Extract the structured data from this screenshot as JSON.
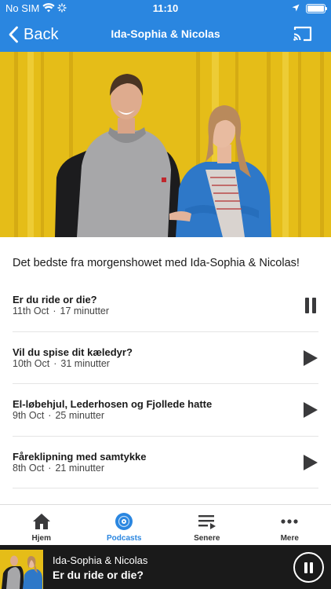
{
  "status_bar": {
    "carrier": "No SIM",
    "time": "11:10",
    "icons": [
      "wifi-icon",
      "activity-spinner-icon",
      "location-arrow-icon",
      "battery-icon"
    ]
  },
  "nav": {
    "back_label": "Back",
    "title": "Ida-Sophia & Nicolas",
    "icons": [
      "chevron-left-icon",
      "cast-icon"
    ]
  },
  "colors": {
    "brand_blue": "#2a86e0",
    "player_bg": "#1a1a1a",
    "hero_yellow": "#e8c21a"
  },
  "description": "Det bedste fra morgenshowet med Ida-Sophia & Nicolas!",
  "episodes": [
    {
      "title": "Er du ride or die?",
      "date": "11th Oct",
      "duration": "17 minutter",
      "state": "playing",
      "control_icon": "pause-icon"
    },
    {
      "title": "Vil du spise dit kæledyr?",
      "date": "10th Oct",
      "duration": "31 minutter",
      "state": "paused",
      "control_icon": "play-icon"
    },
    {
      "title": "El-løbehjul, Lederhosen og Fjollede hatte",
      "date": "9th Oct",
      "duration": "25 minutter",
      "state": "paused",
      "control_icon": "play-icon"
    },
    {
      "title": "Fåreklipning med samtykke",
      "date": "8th Oct",
      "duration": "21 minutter",
      "state": "paused",
      "control_icon": "play-icon"
    }
  ],
  "tabs": [
    {
      "label": "Hjem",
      "icon": "home-icon",
      "active": false
    },
    {
      "label": "Podcasts",
      "icon": "podcast-disc-icon",
      "active": true
    },
    {
      "label": "Senere",
      "icon": "playlist-icon",
      "active": false
    },
    {
      "label": "Mere",
      "icon": "more-dots-icon",
      "active": false
    }
  ],
  "player": {
    "show": "Ida-Sophia & Nicolas",
    "episode": "Er du ride or die?",
    "button_icon": "pause-icon"
  }
}
